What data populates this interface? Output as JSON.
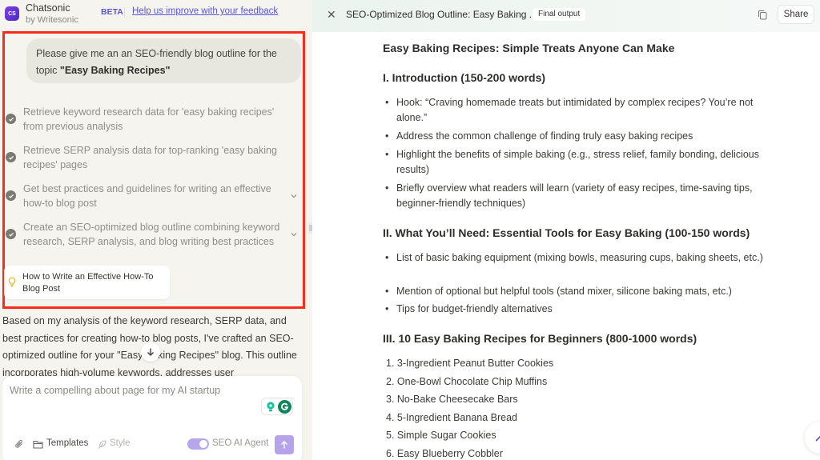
{
  "left_panel": {
    "brand": {
      "logo": "CS",
      "name": "Chatsonic",
      "sub": "by Writesonic"
    },
    "beta_label": "BETA",
    "feedback_link": "Help us improve with your feedback",
    "highlight_color": "#ff2a1a",
    "user_message": {
      "prefix": "Please give me an an SEO-friendly blog outline for the topic ",
      "bold": "\"Easy Baking Recipes\""
    },
    "steps": [
      {
        "text": "Retrieve keyword research data for 'easy baking recipes' from previous analysis",
        "status": "done",
        "expandable": false
      },
      {
        "text": "Retrieve SERP analysis data for top-ranking 'easy baking recipes' pages",
        "status": "done",
        "expandable": false
      },
      {
        "text": "Get best practices and guidelines for writing an effective how-to blog post",
        "status": "done",
        "expandable": true
      },
      {
        "text": "Create an SEO-optimized blog outline combining keyword research, SERP analysis, and blog writing best practices",
        "status": "done",
        "expandable": true
      }
    ],
    "source_card": {
      "icon": "lightbulb-icon",
      "label": "How to Write an Effective How-To Blog Post"
    },
    "response_text": "Based on my analysis of the keyword research, SERP data, and best practices for creating how-to blog posts, I've crafted an SEO-optimized outline for your \"Easy Baking Recipes\" blog. This outline incorporates high-volume keywords, addresses user",
    "composer": {
      "placeholder": "Write a compelling about page for my AI startup",
      "templates_label": "Templates",
      "style_label": "Style",
      "agent_label": "SEO AI Agent",
      "agent_enabled": true
    }
  },
  "right_panel": {
    "title": "SEO-Optimized Blog Outline: Easy Baking ...",
    "badge": "Final output",
    "share_label": "Share",
    "doc": {
      "title": "Easy Baking Recipes: Simple Treats Anyone Can Make",
      "sections": [
        {
          "heading": "I. Introduction (150-200 words)",
          "bullets": [
            "Hook: “Craving homemade treats but intimidated by complex recipes? You’re not alone.”",
            "Address the common challenge of finding truly easy baking recipes",
            "Highlight the benefits of simple baking (e.g., stress relief, family bonding, delicious results)",
            "Briefly overview what readers will learn (variety of easy recipes, time-saving tips, beginner-friendly techniques)"
          ]
        },
        {
          "heading": "II. What You’ll Need: Essential Tools for Easy Baking (100-150 words)",
          "bullets": [
            "List of basic baking equipment (mixing bowls, measuring cups, baking sheets, etc.)",
            "Mention of optional but helpful tools (stand mixer, silicone baking mats, etc.)",
            "Tips for budget-friendly alternatives"
          ]
        },
        {
          "heading": "III. 10 Easy Baking Recipes for Beginners (800-1000 words)",
          "ordered": [
            "1. 3-Ingredient Peanut Butter Cookies",
            "2. One-Bowl Chocolate Chip Muffins",
            "3. No-Bake Cheesecake Bars",
            "4. 5-Ingredient Banana Bread",
            "5. Simple Sugar Cookies",
            "6. Easy Blueberry Cobbler"
          ]
        }
      ]
    }
  }
}
